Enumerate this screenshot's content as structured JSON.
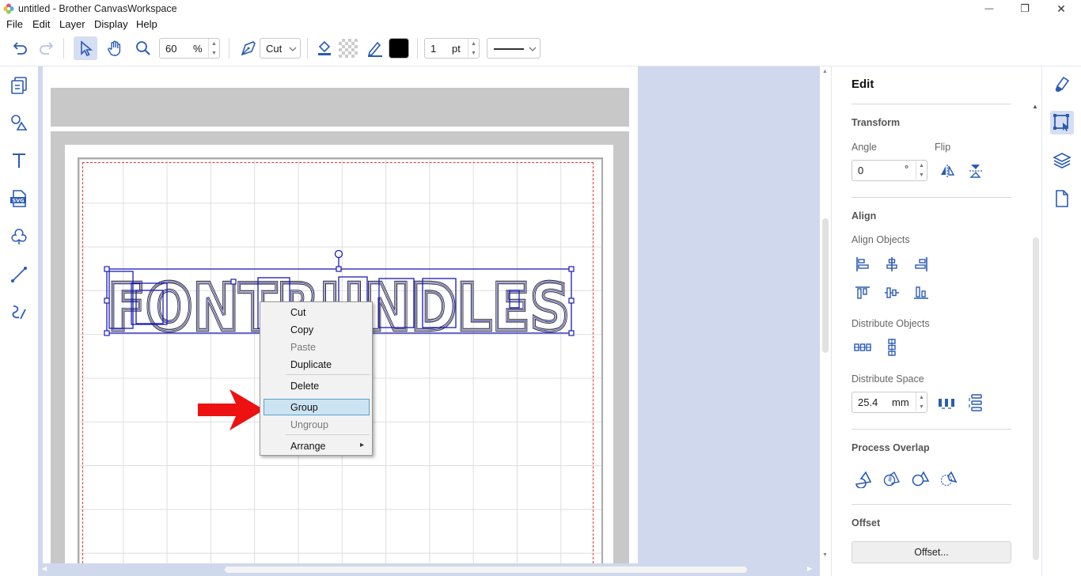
{
  "window": {
    "title": "untitled - Brother CanvasWorkspace",
    "minimize_symbol": "—",
    "restore_symbol": "❐",
    "close_symbol": "✕"
  },
  "menu": [
    "File",
    "Edit",
    "Layer",
    "Display",
    "Help"
  ],
  "toolbar": {
    "zoom_value": "60",
    "zoom_unit": "%",
    "mode_label": "Cut",
    "line_width_value": "1",
    "line_width_unit": "pt",
    "line_color": "#000000",
    "accent": "#1f5fbf"
  },
  "left_tools": [
    "pages-icon",
    "shapes-icon",
    "text-icon",
    "svg-import-icon",
    "cloud-icon",
    "line-icon",
    "freehand-icon"
  ],
  "canvas": {
    "design_text": "FONTRUNDLES",
    "selection_color": "#1a1ab8"
  },
  "context_menu": {
    "items": [
      {
        "label": "Cut",
        "enabled": true
      },
      {
        "label": "Copy",
        "enabled": true
      },
      {
        "label": "Paste",
        "enabled": false
      },
      {
        "label": "Duplicate",
        "enabled": true
      },
      {
        "label": "Delete",
        "enabled": true
      },
      {
        "label": "Group",
        "enabled": true,
        "highlighted": true
      },
      {
        "label": "Ungroup",
        "enabled": false
      },
      {
        "label": "Arrange",
        "enabled": true,
        "submenu": true
      }
    ],
    "submenu_arrow": "▸"
  },
  "annotation": {
    "arrow_color": "#ee1111"
  },
  "right_panel": {
    "title": "Edit",
    "transform": {
      "section": "Transform",
      "angle_label": "Angle",
      "angle_value": "0",
      "angle_unit": "°",
      "flip_label": "Flip"
    },
    "align": {
      "section": "Align",
      "align_objects_label": "Align Objects",
      "distribute_objects_label": "Distribute Objects",
      "distribute_space_label": "Distribute Space",
      "distribute_space_value": "25.4",
      "distribute_space_unit": "mm"
    },
    "process_overlap": {
      "section": "Process Overlap"
    },
    "offset": {
      "section": "Offset",
      "button_label": "Offset..."
    }
  },
  "right_strip": [
    "paint-icon",
    "edit-transform-icon",
    "layers-icon",
    "page-icon"
  ]
}
